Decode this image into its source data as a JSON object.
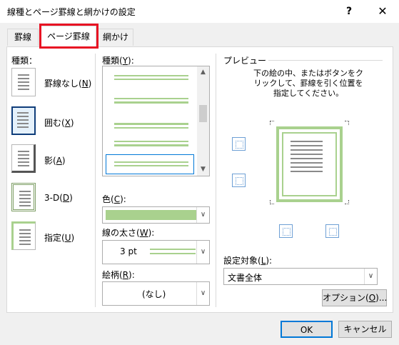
{
  "window": {
    "title": "線種とページ罫線と網かけの設定",
    "help_label": "?",
    "close_label": "✕"
  },
  "tabs": [
    {
      "label": "罫線",
      "selected": false
    },
    {
      "label": "ページ罫線",
      "selected": true
    },
    {
      "label": "網かけ",
      "selected": false
    }
  ],
  "setting": {
    "label": "種類：",
    "items": [
      {
        "text": "罫線なし(",
        "key": "N",
        "close": ")"
      },
      {
        "text": "囲む(",
        "key": "X",
        "close": ")"
      },
      {
        "text": "影(",
        "key": "A",
        "close": ")"
      },
      {
        "text": "3-D(",
        "key": "D",
        "close": ")"
      },
      {
        "text": "指定(",
        "key": "U",
        "close": ")"
      }
    ],
    "selected_index": 1
  },
  "style": {
    "label_text": "種類(",
    "label_key": "Y",
    "label_close": "):"
  },
  "color": {
    "label_text": "色(",
    "label_key": "C",
    "label_close": "):",
    "value_hex": "#a9d18e"
  },
  "width": {
    "label_text": "線の太さ(",
    "label_key": "W",
    "label_close": "):",
    "value": "3 pt"
  },
  "art": {
    "label_text": "絵柄(",
    "label_key": "R",
    "label_close": "):",
    "value": "(なし)"
  },
  "preview": {
    "label": "プレビュー",
    "note": "下の絵の中、またはボタンをクリックして、罫線を引く位置を指定してください。"
  },
  "apply_to": {
    "label_text": "設定対象(",
    "label_key": "L",
    "label_close": "):",
    "value": "文書全体"
  },
  "buttons": {
    "options_text": "オプション(",
    "options_key": "O",
    "options_close": ")...",
    "ok": "OK",
    "cancel": "キャンセル"
  },
  "colors": {
    "accent": "#a9d18e",
    "tab_highlight": "#e81123",
    "focus": "#0078d7"
  }
}
